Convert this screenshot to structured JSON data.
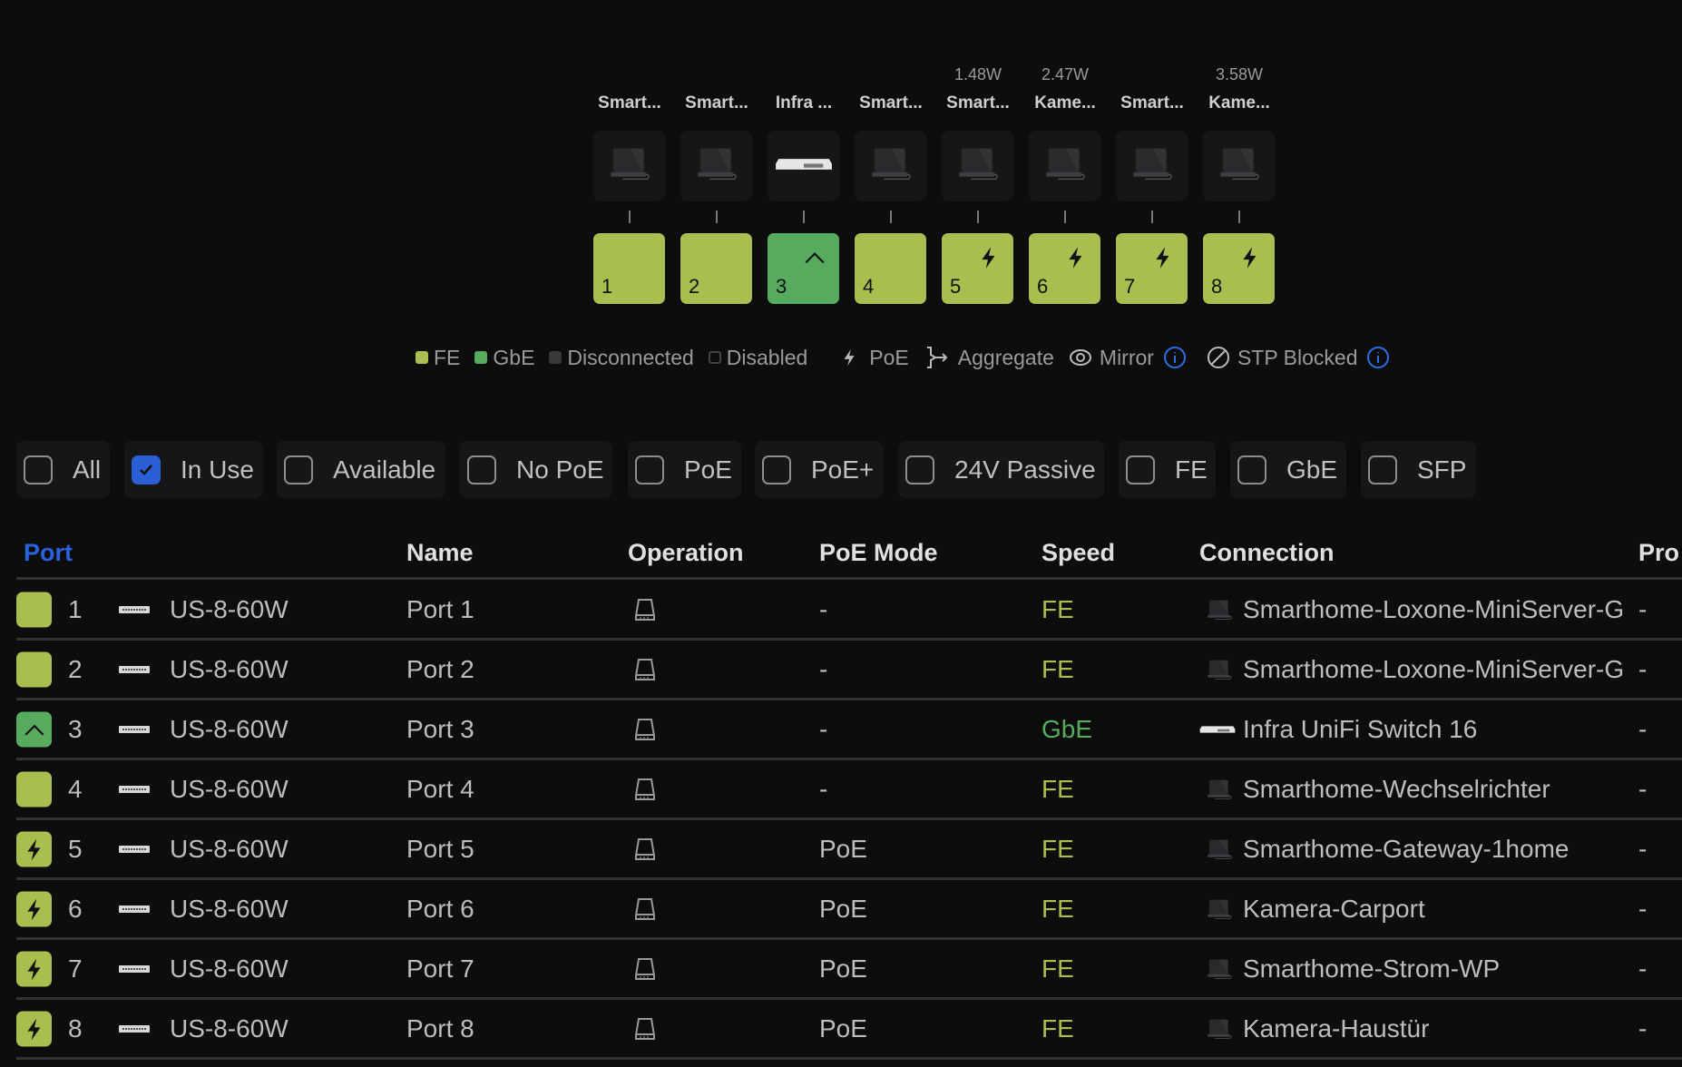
{
  "colors": {
    "fe": "#a8bf4f",
    "gbe": "#56ab5e",
    "disconnected": "#3a3a3c",
    "accent": "#2a5fd6"
  },
  "ports": [
    {
      "num": "1",
      "name": "Smart...",
      "watt": "",
      "type": "fe",
      "icon": "",
      "device": "device"
    },
    {
      "num": "2",
      "name": "Smart...",
      "watt": "",
      "type": "fe",
      "icon": "",
      "device": "device"
    },
    {
      "num": "3",
      "name": "Infra ...",
      "watt": "",
      "type": "gbe",
      "icon": "uplink",
      "device": "switch"
    },
    {
      "num": "4",
      "name": "Smart...",
      "watt": "",
      "type": "fe",
      "icon": "",
      "device": "device"
    },
    {
      "num": "5",
      "name": "Smart...",
      "watt": "1.48W",
      "type": "fe",
      "icon": "poe",
      "device": "device"
    },
    {
      "num": "6",
      "name": "Kame...",
      "watt": "2.47W",
      "type": "fe",
      "icon": "poe",
      "device": "device"
    },
    {
      "num": "7",
      "name": "Smart...",
      "watt": "",
      "type": "fe",
      "icon": "poe",
      "device": "device"
    },
    {
      "num": "8",
      "name": "Kame...",
      "watt": "3.58W",
      "type": "fe",
      "icon": "poe",
      "device": "device"
    }
  ],
  "legend": {
    "fe": "FE",
    "gbe": "GbE",
    "disconnected": "Disconnected",
    "disabled": "Disabled",
    "poe": "PoE",
    "aggregate": "Aggregate",
    "mirror": "Mirror",
    "stp": "STP Blocked"
  },
  "filters": [
    {
      "label": "All",
      "checked": false
    },
    {
      "label": "In Use",
      "checked": true
    },
    {
      "label": "Available",
      "checked": false
    },
    {
      "label": "No PoE",
      "checked": false
    },
    {
      "label": "PoE",
      "checked": false
    },
    {
      "label": "PoE+",
      "checked": false
    },
    {
      "label": "24V Passive",
      "checked": false
    },
    {
      "label": "FE",
      "checked": false
    },
    {
      "label": "GbE",
      "checked": false
    },
    {
      "label": "SFP",
      "checked": false
    }
  ],
  "table": {
    "headers": [
      "Port",
      "Name",
      "Operation",
      "PoE Mode",
      "Speed",
      "Connection",
      "Pro"
    ],
    "rows": [
      {
        "port": "1",
        "device": "US-8-60W",
        "name": "Port 1",
        "poe": "-",
        "speed": "FE",
        "conn": "Smarthome-Loxone-MiniServer-G",
        "pro": "-",
        "type": "fe",
        "icon": ""
      },
      {
        "port": "2",
        "device": "US-8-60W",
        "name": "Port 2",
        "poe": "-",
        "speed": "FE",
        "conn": "Smarthome-Loxone-MiniServer-G",
        "pro": "-",
        "type": "fe",
        "icon": ""
      },
      {
        "port": "3",
        "device": "US-8-60W",
        "name": "Port 3",
        "poe": "-",
        "speed": "GbE",
        "conn": "Infra UniFi Switch 16",
        "pro": "-",
        "type": "gbe",
        "icon": "uplink"
      },
      {
        "port": "4",
        "device": "US-8-60W",
        "name": "Port 4",
        "poe": "-",
        "speed": "FE",
        "conn": "Smarthome-Wechselrichter",
        "pro": "-",
        "type": "fe",
        "icon": ""
      },
      {
        "port": "5",
        "device": "US-8-60W",
        "name": "Port 5",
        "poe": "PoE",
        "speed": "FE",
        "conn": "Smarthome-Gateway-1home",
        "pro": "-",
        "type": "fe",
        "icon": "poe"
      },
      {
        "port": "6",
        "device": "US-8-60W",
        "name": "Port 6",
        "poe": "PoE",
        "speed": "FE",
        "conn": "Kamera-Carport",
        "pro": "-",
        "type": "fe",
        "icon": "poe"
      },
      {
        "port": "7",
        "device": "US-8-60W",
        "name": "Port 7",
        "poe": "PoE",
        "speed": "FE",
        "conn": "Smarthome-Strom-WP",
        "pro": "-",
        "type": "fe",
        "icon": "poe"
      },
      {
        "port": "8",
        "device": "US-8-60W",
        "name": "Port 8",
        "poe": "PoE",
        "speed": "FE",
        "conn": "Kamera-Haustür",
        "pro": "-",
        "type": "fe",
        "icon": "poe"
      }
    ]
  }
}
